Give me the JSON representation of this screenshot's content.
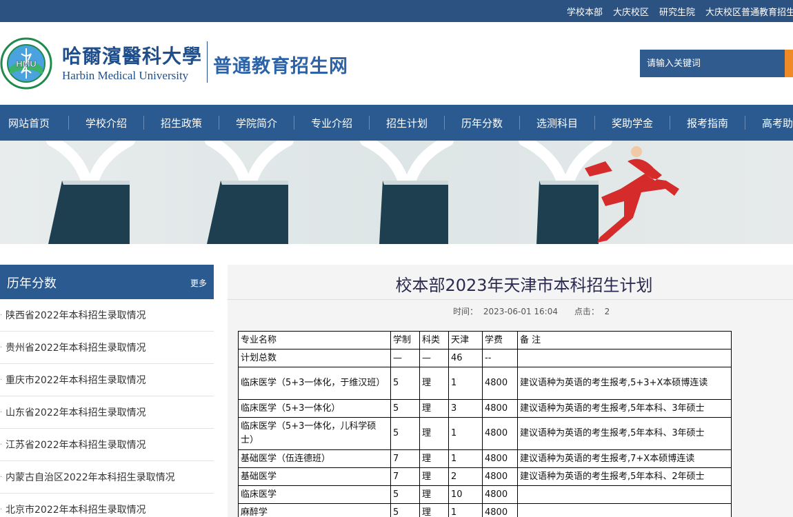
{
  "topbar": {
    "links": [
      "学校本部",
      "大庆校区",
      "研究生院",
      "大庆校区普通教育招生网"
    ]
  },
  "header": {
    "logo_cn": "哈爾濱醫科大學",
    "logo_en": "Harbin Medical University",
    "logo_badge": "HMU",
    "site_name": "普通教育招生网",
    "search_placeholder": "请输入关键词"
  },
  "nav": {
    "items": [
      "网站首页",
      "学校介绍",
      "招生政策",
      "学院简介",
      "专业介绍",
      "招生计划",
      "历年分数",
      "选测科目",
      "奖助学金",
      "报考指南",
      "高考助力"
    ]
  },
  "sidebar": {
    "title": "历年分数",
    "more": "更多",
    "items": [
      "陕西省2022年本科招生录取情况",
      "贵州省2022年本科招生录取情况",
      "重庆市2022年本科招生录取情况",
      "山东省2022年本科招生录取情况",
      "江苏省2022年本科招生录取情况",
      "内蒙古自治区2022年本科招生录取情况",
      "北京市2022年本科招生录取情况"
    ]
  },
  "article": {
    "title": "校本部2023年天津市本科招生计划",
    "time_label": "时间：",
    "time": "2023-06-01 16:04",
    "clicks_label": "点击：",
    "clicks": "2",
    "table": {
      "headers": [
        "专业名称",
        "学制",
        "科类",
        "天津",
        "学费",
        "备 注"
      ],
      "rows": [
        [
          "计划总数",
          "—",
          "—",
          "46",
          "--",
          ""
        ],
        [
          "临床医学（5+3一体化，于维汉班）",
          "5",
          "理",
          "1",
          "4800",
          "建议语种为英语的考生报考,5+3+X本硕博连读"
        ],
        [
          "临床医学（5+3一体化）",
          "5",
          "理",
          "3",
          "4800",
          "建议语种为英语的考生报考,5年本科、3年硕士"
        ],
        [
          "临床医学（5+3一体化，儿科学硕士）",
          "5",
          "理",
          "1",
          "4800",
          "建议语种为英语的考生报考,5年本科、3年硕士"
        ],
        [
          "基础医学（伍连德班）",
          "7",
          "理",
          "1",
          "4800",
          "建议语种为英语的考生报考,7+X本硕博连读"
        ],
        [
          "基础医学",
          "7",
          "理",
          "2",
          "4800",
          "建议语种为英语的考生报考,5年本科、2年硕士"
        ],
        [
          "临床医学",
          "5",
          "理",
          "10",
          "4800",
          ""
        ],
        [
          "麻醉学",
          "5",
          "理",
          "1",
          "4800",
          ""
        ]
      ]
    }
  },
  "colors": {
    "primary": "#2b5a90",
    "topbar": "#2c5282",
    "accent": "#f08a24",
    "banner_figure": "#d62b2b"
  }
}
